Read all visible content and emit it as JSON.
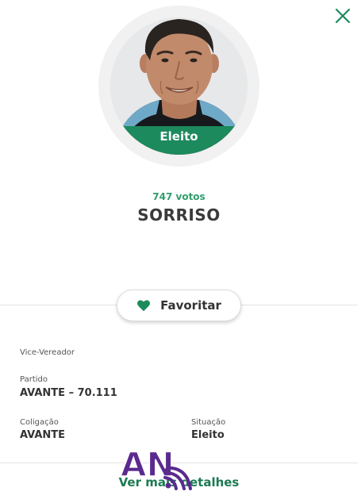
{
  "profile": {
    "badge": "Eleito",
    "votes": "747 votos",
    "name": "SORRISO"
  },
  "actions": {
    "favorite_label": "Favoritar",
    "details_label": "Ver mais detalhes"
  },
  "details": {
    "role": "Vice-Vereador",
    "party_label": "Partido",
    "party_value": "AVANTE – 70.111",
    "coalition_label": "Coligação",
    "coalition_value": "AVANTE",
    "status_label": "Situação",
    "status_value": "Eleito"
  },
  "watermark": {
    "text": "AN"
  },
  "icons": {
    "close": "close-icon",
    "favorite": "heart-icon"
  },
  "colors": {
    "accent": "#1c8a5c",
    "votes": "#2f9e6c",
    "link": "#1c7a52",
    "watermark": "#5b2a8f"
  }
}
